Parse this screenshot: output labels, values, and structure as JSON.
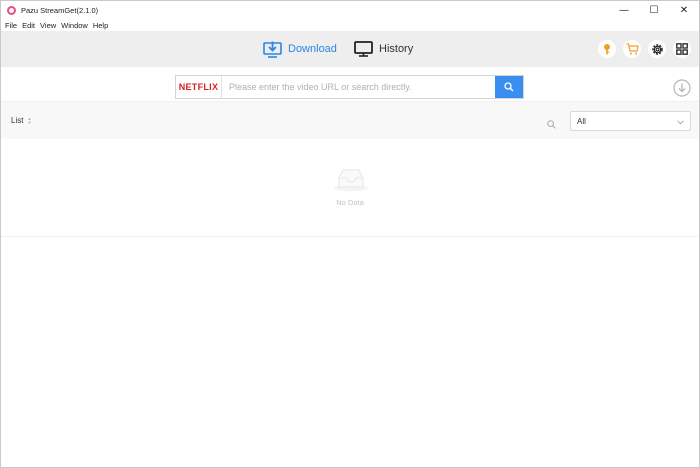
{
  "window": {
    "title": "Pazu StreamGet(2.1.0)",
    "controls": {
      "minimize": "—",
      "maximize": "☐",
      "close": "✕"
    }
  },
  "menu": [
    "File",
    "Edit",
    "View",
    "Window",
    "Help"
  ],
  "toolbar": {
    "tabs": [
      {
        "label": "Download",
        "icon": "download-monitor-icon",
        "active": true
      },
      {
        "label": "History",
        "icon": "monitor-icon",
        "active": false
      }
    ],
    "actions": [
      "key-icon",
      "cart-icon",
      "gear-icon",
      "grid-icon"
    ]
  },
  "search": {
    "brand": "NETFLIX",
    "placeholder": "Please enter the video URL or search directly.",
    "value": ""
  },
  "list": {
    "label": "List",
    "filter_value": "All"
  },
  "empty_state": {
    "text": "No Data"
  },
  "colors": {
    "accent": "#2a86e8",
    "search_button": "#3a8ef0",
    "brand_red": "#d81f26",
    "key_icon": "#f0a020"
  }
}
